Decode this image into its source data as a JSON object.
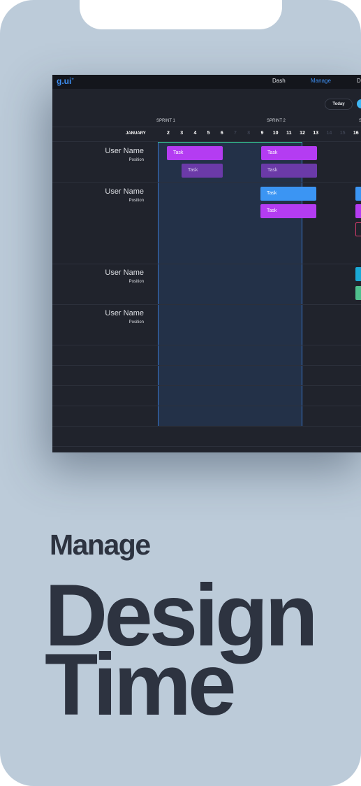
{
  "app": {
    "logo": "g.ui",
    "logo_mark": "+"
  },
  "nav": [
    {
      "label": "Dash",
      "active": false
    },
    {
      "label": "Manage",
      "active": true
    },
    {
      "label": "De",
      "active": false
    }
  ],
  "toolbar": {
    "today_label": "Today"
  },
  "sprints": [
    "SPRINT 1",
    "SPRINT 2",
    "S"
  ],
  "month": "JANUARY",
  "days": [
    {
      "label": "2",
      "dim": false
    },
    {
      "label": "3",
      "dim": false
    },
    {
      "label": "4",
      "dim": false
    },
    {
      "label": "5",
      "dim": false
    },
    {
      "label": "6",
      "dim": false
    },
    {
      "label": "7",
      "dim": true
    },
    {
      "label": "8",
      "dim": true
    },
    {
      "label": "9",
      "dim": false
    },
    {
      "label": "10",
      "dim": false
    },
    {
      "label": "11",
      "dim": false
    },
    {
      "label": "12",
      "dim": false
    },
    {
      "label": "13",
      "dim": false
    },
    {
      "label": "14",
      "dim": true
    },
    {
      "label": "15",
      "dim": true
    },
    {
      "label": "16",
      "dim": false
    }
  ],
  "users": [
    {
      "name": "User Name",
      "position": "Position"
    },
    {
      "name": "User Name",
      "position": "Position"
    },
    {
      "name": "User Name",
      "position": "Position"
    },
    {
      "name": "User Name",
      "position": "Position"
    }
  ],
  "tasks": [
    {
      "label": "Task",
      "style": "magenta"
    },
    {
      "label": "Task",
      "style": "magenta"
    },
    {
      "label": "Task",
      "style": "dim"
    },
    {
      "label": "Task",
      "style": "dim"
    },
    {
      "label": "Task",
      "style": "blue"
    },
    {
      "label": "Task",
      "style": "magenta"
    }
  ],
  "colors": {
    "accent": "#3e8ef0",
    "magenta": "#b43cf2",
    "blue": "#3b95f3",
    "cyan": "#1aa9d6",
    "green": "#4fc08d",
    "background": "#bccbd9"
  },
  "headline": {
    "kicker": "Manage",
    "line1": "Design",
    "line2": "Time"
  }
}
